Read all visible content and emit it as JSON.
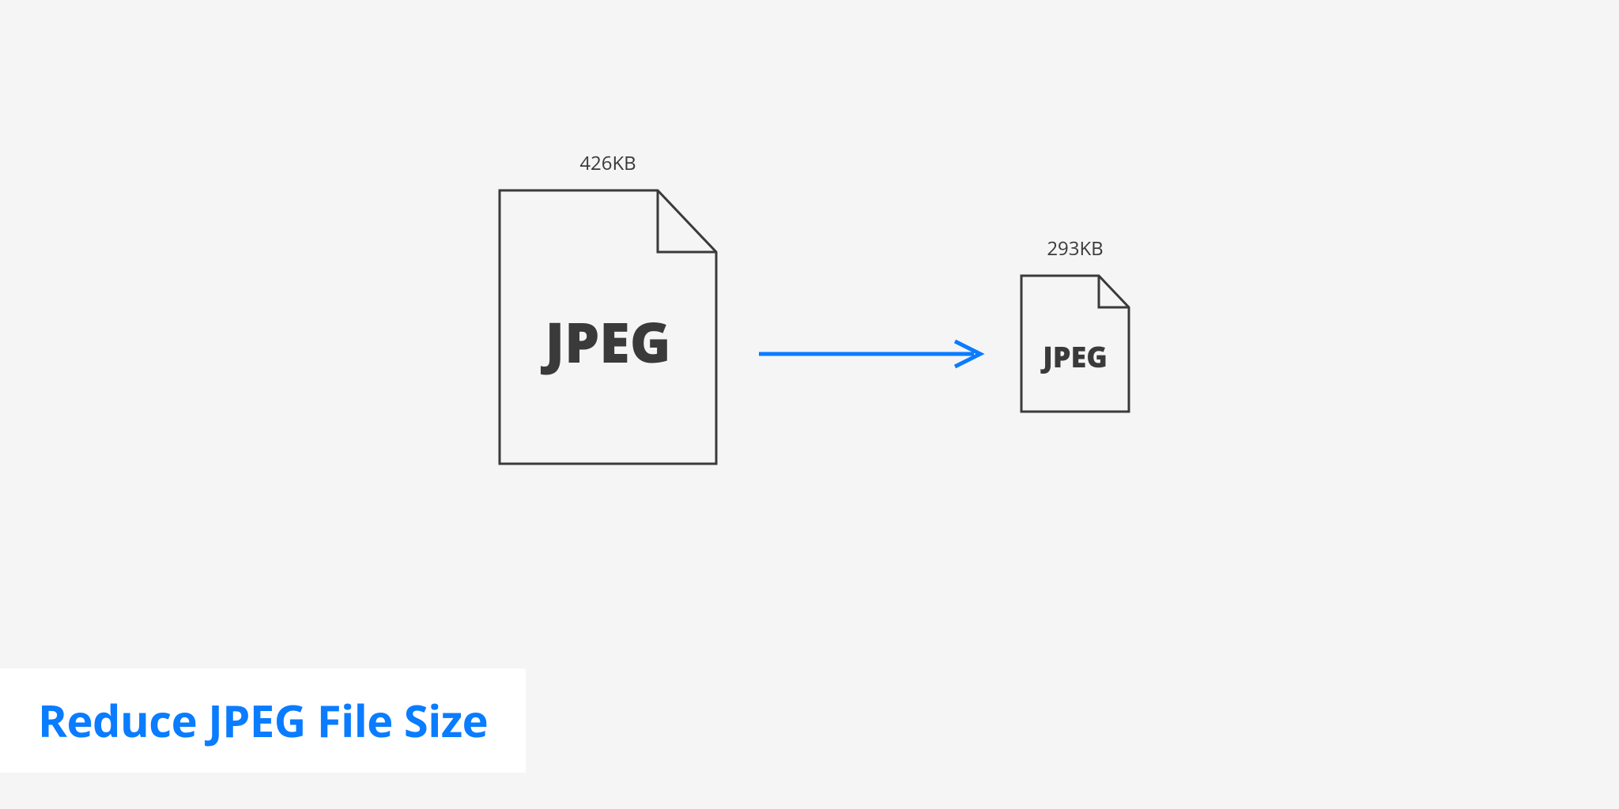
{
  "diagram": {
    "left_file": {
      "size_label": "426KB",
      "format": "JPEG"
    },
    "right_file": {
      "size_label": "293KB",
      "format": "JPEG"
    }
  },
  "title": "Reduce JPEG File Size",
  "colors": {
    "accent": "#0a7cff",
    "stroke": "#3a3a3a",
    "bg": "#f5f5f5",
    "panel": "#ffffff"
  }
}
